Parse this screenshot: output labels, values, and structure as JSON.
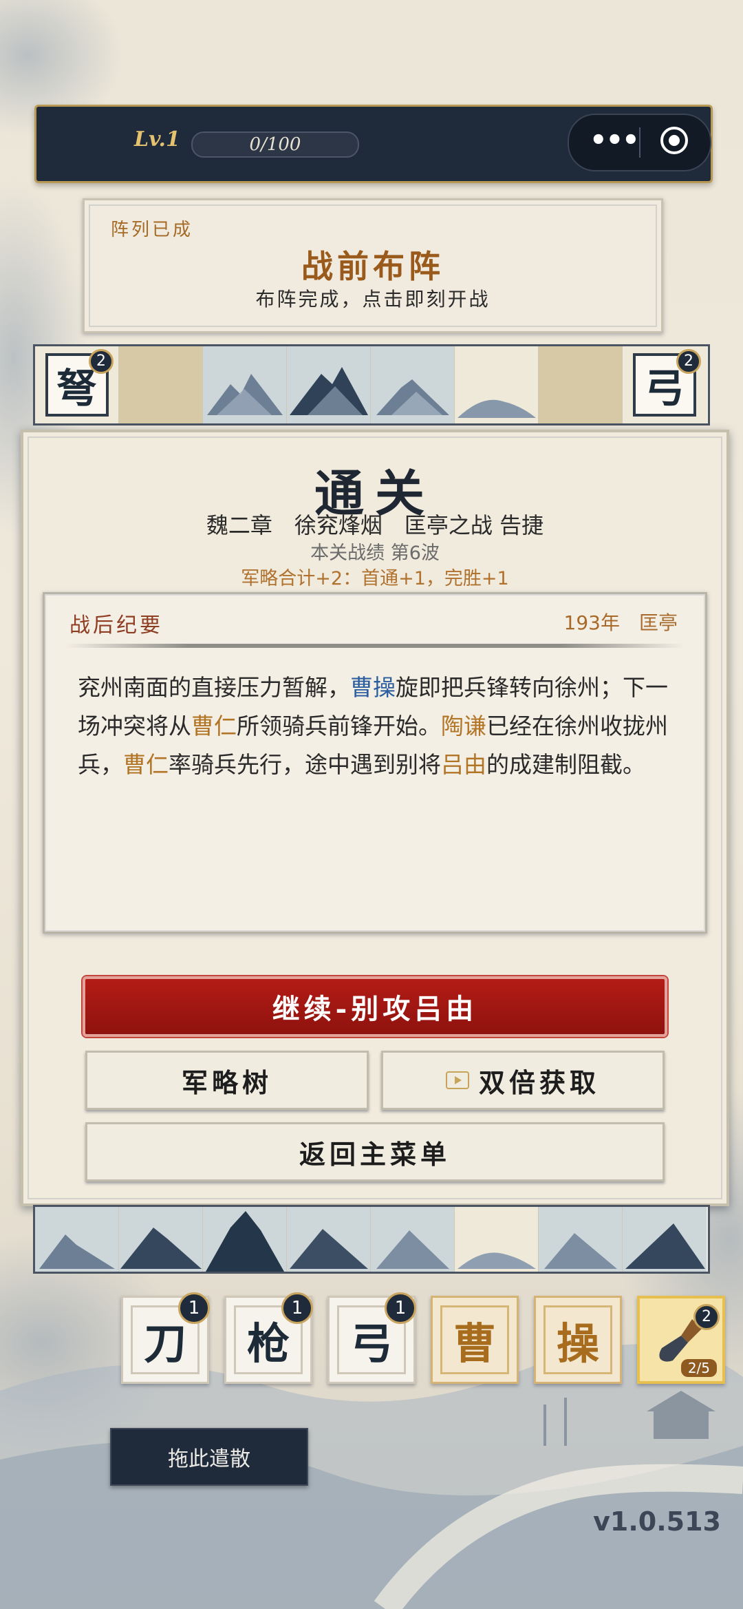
{
  "topbar": {
    "level": "Lv.1",
    "xp": "0/100",
    "menu_dots": "•••"
  },
  "banner": {
    "tag": "阵列已成",
    "title": "战前布阵",
    "subtitle": "布阵完成，点击即刻开战"
  },
  "top_row": {
    "left_unit": {
      "char": "弩",
      "count": "2"
    },
    "right_unit": {
      "char": "弓",
      "count": "2"
    },
    "terrain": [
      "sand",
      "mountain",
      "mountain",
      "mountain",
      "plain",
      "sand"
    ]
  },
  "result": {
    "title": "通关",
    "chapter": "魏二章　徐兖烽烟　匡亭之战 告捷",
    "wave": "本关战绩 第6波",
    "strategy": "军略合计+2：首通+1，完胜+1"
  },
  "notes": {
    "heading": "战后纪要",
    "date": "193年　匡亭",
    "segments": [
      {
        "text": "兖州南面的直接压力暂解，",
        "style": "normal"
      },
      {
        "text": "曹操",
        "style": "blue"
      },
      {
        "text": "旋即把兵锋转向徐州；下一场冲突将从",
        "style": "normal"
      },
      {
        "text": "曹仁",
        "style": "gold"
      },
      {
        "text": "所领骑兵前锋开始。",
        "style": "normal"
      },
      {
        "text": "陶谦",
        "style": "gold"
      },
      {
        "text": "已经在徐州收拢州兵，",
        "style": "normal"
      },
      {
        "text": "曹仁",
        "style": "gold"
      },
      {
        "text": "率骑兵先行，途中遇到别将",
        "style": "normal"
      },
      {
        "text": "吕由",
        "style": "gold"
      },
      {
        "text": "的成建制阻截。",
        "style": "normal"
      }
    ]
  },
  "buttons": {
    "continue": "继续-别攻吕由",
    "strategy_tree": "军略树",
    "double_reward": "双倍获取",
    "main_menu": "返回主菜单"
  },
  "bottom_row": {
    "terrain": [
      "mountain",
      "mountain",
      "mountain",
      "mountain",
      "mountain",
      "plain",
      "mountain",
      "mountain"
    ]
  },
  "bench": [
    {
      "char": "刀",
      "count": "1",
      "kind": "unit"
    },
    {
      "char": "枪",
      "count": "1",
      "kind": "unit"
    },
    {
      "char": "弓",
      "count": "1",
      "kind": "unit"
    },
    {
      "char": "曹",
      "kind": "hero"
    },
    {
      "char": "操",
      "kind": "hero"
    },
    {
      "icon": "shovel-icon",
      "count": "2",
      "uses": "2/5",
      "kind": "tool"
    }
  ],
  "discard_label": "拖此遣散",
  "version": "v1.0.513",
  "colors": {
    "navy": "#1f2a3a",
    "gold": "#c9a45c",
    "red": "#a8170f",
    "paper": "#f1ebde"
  }
}
